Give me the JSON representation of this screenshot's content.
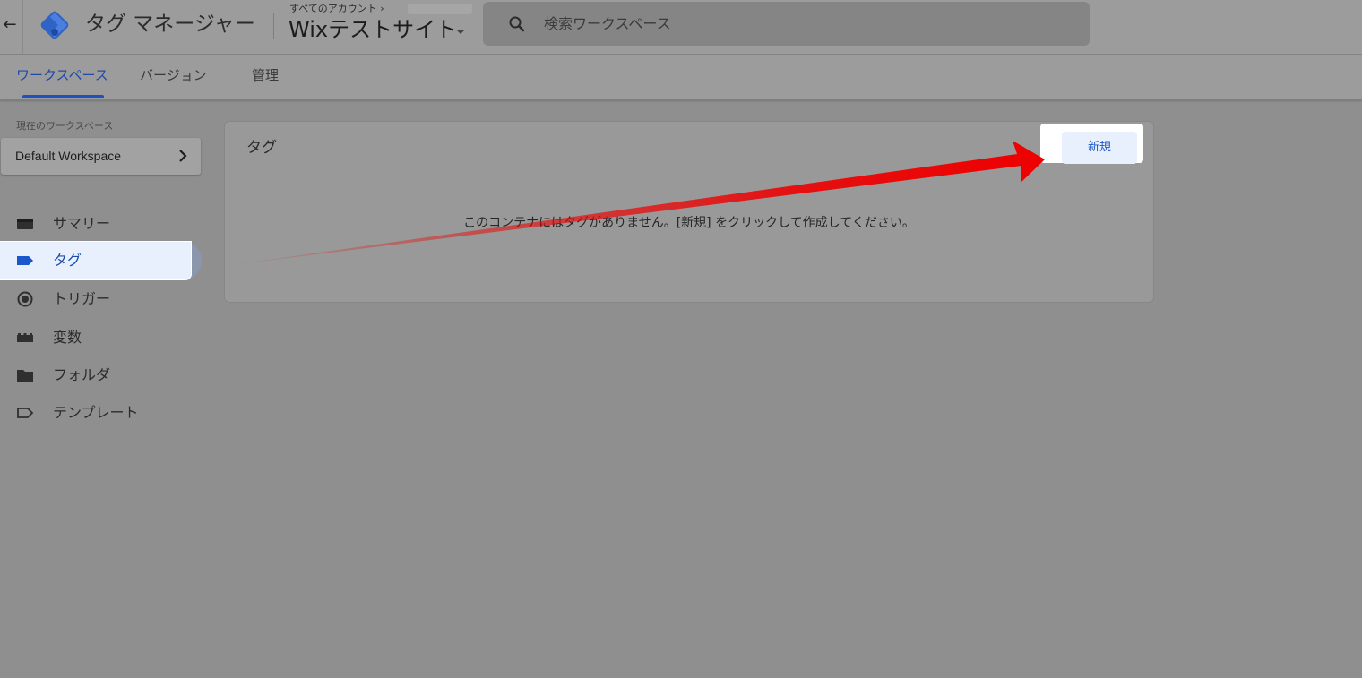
{
  "header": {
    "back_icon": "arrow-left-icon",
    "logo_icon": "tag-manager-logo-icon",
    "app_name": "タグ マネージャー",
    "breadcrumb": "すべてのアカウント ›",
    "container_name": "Wixテストサイト",
    "container_caret_icon": "caret-down-icon",
    "search": {
      "icon": "search-icon",
      "placeholder": "検索ワークスペース"
    }
  },
  "tabs": [
    {
      "label": "ワークスペース",
      "active": true
    },
    {
      "label": "バージョン",
      "active": false
    },
    {
      "label": "管理",
      "active": false
    }
  ],
  "sidebar": {
    "workspace_label": "現在のワークスペース",
    "workspace_name": "Default Workspace",
    "workspace_chevron_icon": "chevron-right-icon",
    "items": [
      {
        "label": "サマリー",
        "icon": "summary-icon",
        "selected": false
      },
      {
        "label": "タグ",
        "icon": "tag-icon",
        "selected": true
      },
      {
        "label": "トリガー",
        "icon": "trigger-icon",
        "selected": false
      },
      {
        "label": "変数",
        "icon": "variables-icon",
        "selected": false
      },
      {
        "label": "フォルダ",
        "icon": "folder-icon",
        "selected": false
      },
      {
        "label": "テンプレート",
        "icon": "template-icon",
        "selected": false
      }
    ]
  },
  "main": {
    "card_title": "タグ",
    "new_button_label": "新規",
    "empty_message": "このコンテナにはタグがありません。[新規] をクリックして作成してください。"
  },
  "annotation": {
    "arrow_color": "#ee0000"
  },
  "colors": {
    "accent_blue": "#1f4aa8",
    "selected_bg": "#e8f0fe",
    "overlay_gray": "#8f8f8f"
  }
}
